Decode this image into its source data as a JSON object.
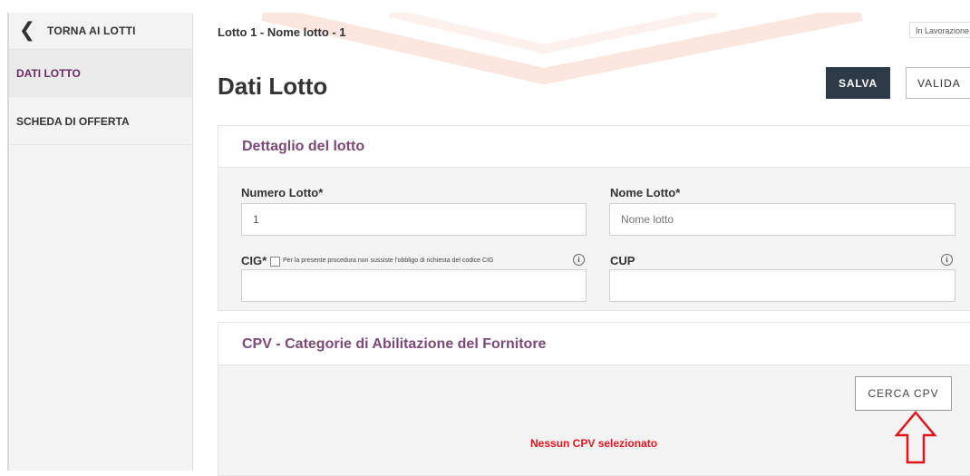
{
  "sidebar": {
    "back_label": "TORNA AI LOTTI",
    "items": [
      {
        "label": "DATI LOTTO",
        "active": true
      },
      {
        "label": "SCHEDA DI OFFERTA",
        "active": false
      }
    ]
  },
  "header": {
    "breadcrumb": "Lotto 1 - Nome lotto - 1",
    "status": "In Lavorazione",
    "title": "Dati Lotto",
    "save_label": "SALVA",
    "validate_label": "VALIDA"
  },
  "detail": {
    "title": "Dettaglio del lotto",
    "numero_label": "Numero Lotto*",
    "numero_value": "1",
    "nome_label": "Nome Lotto*",
    "nome_placeholder": "Nome lotto",
    "cig_label": "CIG*",
    "cig_note": "Per la presente procedura non sussiste l'obbligo di richiesta del codice CIG",
    "cig_value": "",
    "cup_label": "CUP",
    "cup_value": ""
  },
  "cpv": {
    "title": "CPV - Categorie di Abilitazione del Fornitore",
    "search_label": "CERCA CPV",
    "empty_message": "Nessun CPV selezionato"
  },
  "colors": {
    "accent_purple": "#7b4a78",
    "active_item": "#6b2c5f",
    "save_button": "#2d3a47",
    "error_red": "#e8141c"
  },
  "icons": {
    "back": "chevron-left-icon",
    "info": "info-icon",
    "annotation": "up-arrow-icon"
  }
}
